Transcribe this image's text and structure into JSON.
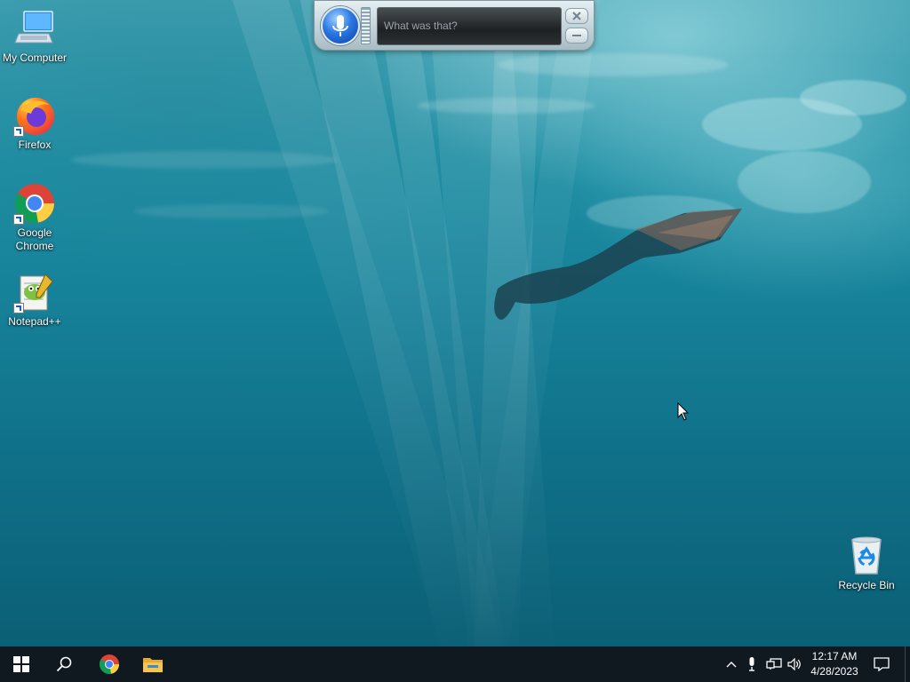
{
  "desktop": {
    "icons": [
      {
        "label": "My Computer",
        "icon": "my-computer-icon"
      },
      {
        "label": "Firefox",
        "icon": "firefox-icon",
        "shortcut": true
      },
      {
        "label": "Google Chrome",
        "icon": "chrome-icon",
        "shortcut": true
      },
      {
        "label": "Notepad++",
        "icon": "notepad-plus-plus-icon",
        "shortcut": true
      },
      {
        "label": "Recycle Bin",
        "icon": "recycle-bin-icon"
      }
    ]
  },
  "speech_recognition": {
    "status_text": "What was that?",
    "mic_icon": "microphone-icon",
    "close_icon": "close-icon",
    "minimize_icon": "minimize-icon"
  },
  "taskbar": {
    "start_icon": "windows-start-icon",
    "search_icon": "search-icon",
    "pinned": [
      {
        "name": "Google Chrome",
        "icon": "chrome-icon"
      },
      {
        "name": "File Explorer",
        "icon": "file-explorer-icon"
      }
    ],
    "tray": {
      "icons": [
        "chevron-up-icon",
        "microphone-icon",
        "network-icon",
        "volume-icon"
      ],
      "time": "12:17 AM",
      "date": "4/28/2023",
      "notification_icon": "action-center-icon"
    }
  },
  "colors": {
    "taskbar_bg": "#101820",
    "water_top": "#3d9fb0",
    "water_bottom": "#0b5f75"
  }
}
